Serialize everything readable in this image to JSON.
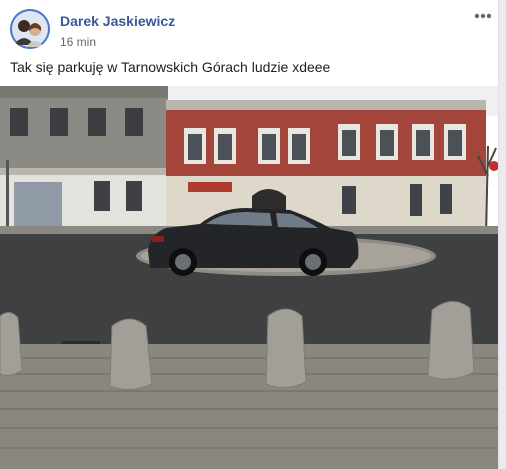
{
  "post": {
    "author": "Darek Jaskiewicz",
    "timestamp": "16 min",
    "text": "Tak się parkuję w Tarnowskich Górach ludzie xdeee",
    "photo_subject": "black sedan parked on a roundabout in front of buildings"
  },
  "icons": {
    "menu": "more-options-icon",
    "avatar": "profile-avatar"
  },
  "colors": {
    "author_link": "#385898",
    "meta_text": "#616770",
    "body_text": "#1c1e21",
    "page_bg": "#e9ebee"
  }
}
